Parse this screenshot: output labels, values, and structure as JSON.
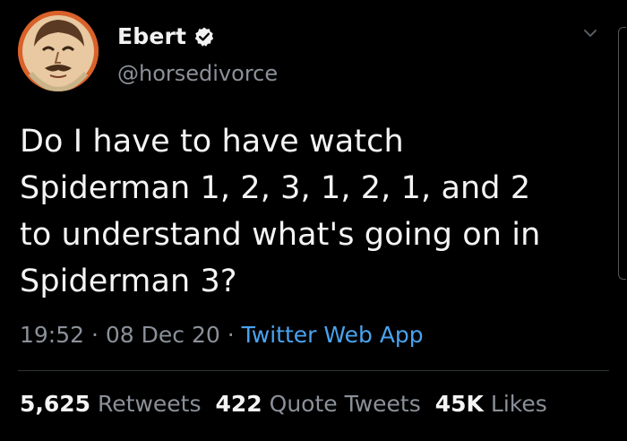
{
  "author": {
    "display_name": "Ebert",
    "handle": "@horsedivorce",
    "verified": true,
    "avatar_icon": "caricature-avatar-icon"
  },
  "tweet": {
    "lines": [
      "Do I have to have watch",
      "Spiderman 1, 2, 3, 1, 2, 1, and 2",
      "to understand what's going on in",
      "Spiderman 3?"
    ]
  },
  "meta": {
    "time": "19:52",
    "sep1": " · ",
    "date": "08 Dec 20",
    "sep2": " · ",
    "source": "Twitter Web App"
  },
  "stats": {
    "retweets_count": "5,625",
    "retweets_label": "Retweets",
    "quotes_count": "422",
    "quotes_label": "Quote Tweets",
    "likes_count": "45K",
    "likes_label": "Likes"
  },
  "colors": {
    "background": "#000000",
    "text": "#f4f4f4",
    "muted": "#8a9099",
    "link": "#4aa3ee",
    "avatar_bg": "#d9612a"
  }
}
